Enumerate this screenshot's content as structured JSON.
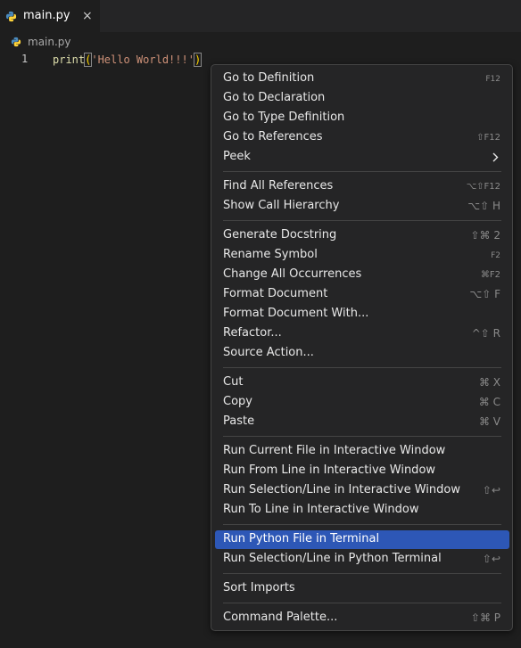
{
  "tab": {
    "label": "main.py",
    "close": "×"
  },
  "breadcrumb": {
    "label": "main.py"
  },
  "editor": {
    "line_number": "1",
    "code": {
      "fn": "print",
      "open": "(",
      "str": "'Hello World!!!'",
      "close": ")"
    }
  },
  "menu": {
    "items": [
      {
        "label": "Go to Definition",
        "key": "F12"
      },
      {
        "label": "Go to Declaration",
        "key": ""
      },
      {
        "label": "Go to Type Definition",
        "key": ""
      },
      {
        "label": "Go to References",
        "key": "⇧F12"
      },
      {
        "label": "Peek",
        "key": ""
      },
      {
        "label": "Find All References",
        "key": "⌥⇧F12"
      },
      {
        "label": "Show Call Hierarchy",
        "key": "⌥⇧ H"
      },
      {
        "label": "Generate Docstring",
        "key": "⇧⌘ 2"
      },
      {
        "label": "Rename Symbol",
        "key": "F2"
      },
      {
        "label": "Change All Occurrences",
        "key": "⌘F2"
      },
      {
        "label": "Format Document",
        "key": "⌥⇧ F"
      },
      {
        "label": "Format Document With...",
        "key": ""
      },
      {
        "label": "Refactor...",
        "key": "^⇧ R"
      },
      {
        "label": "Source Action...",
        "key": ""
      },
      {
        "label": "Cut",
        "key": "⌘ X"
      },
      {
        "label": "Copy",
        "key": "⌘ C"
      },
      {
        "label": "Paste",
        "key": "⌘ V"
      },
      {
        "label": "Run Current File in Interactive Window",
        "key": ""
      },
      {
        "label": "Run From Line in Interactive Window",
        "key": ""
      },
      {
        "label": "Run Selection/Line in Interactive Window",
        "key": "⇧↩"
      },
      {
        "label": "Run To Line in Interactive Window",
        "key": ""
      },
      {
        "label": "Run Python File in Terminal",
        "key": ""
      },
      {
        "label": "Run Selection/Line in Python Terminal",
        "key": "⇧↩"
      },
      {
        "label": "Sort Imports",
        "key": ""
      },
      {
        "label": "Command Palette...",
        "key": "⇧⌘ P"
      }
    ]
  },
  "colors": {
    "selected_item": "#2d57b6",
    "python_blue": "#4b8bbe",
    "python_yellow": "#ffd43b"
  }
}
